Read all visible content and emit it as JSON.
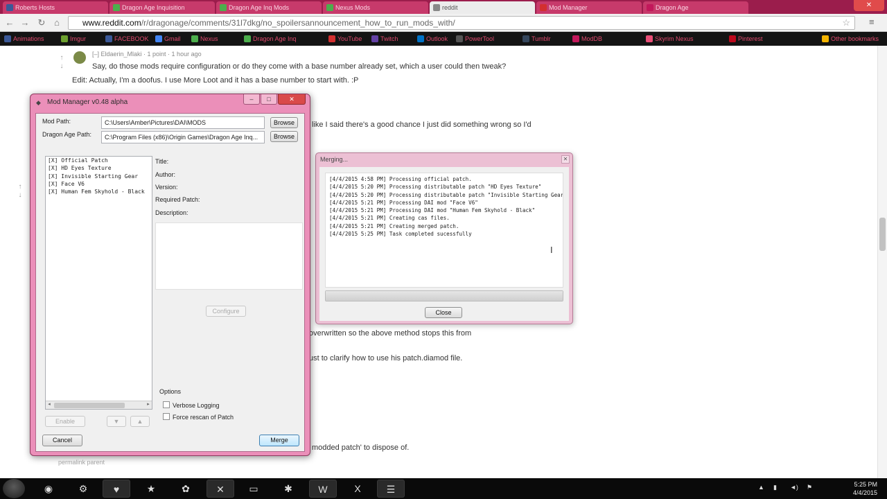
{
  "browser": {
    "tabs": [
      {
        "label": "Roberts Hosts",
        "color": "#3b5998",
        "active": false
      },
      {
        "label": "Dragon Age Inquisition",
        "color": "#4cae4c",
        "active": false
      },
      {
        "label": "Dragon Age Inq Mods",
        "color": "#4cae4c",
        "active": false
      },
      {
        "label": "Nexus Mods",
        "color": "#4cae4c",
        "active": false
      },
      {
        "label": "reddit",
        "color": "#888888",
        "active": true
      },
      {
        "label": "Mod Manager",
        "color": "#d32f2f",
        "active": false
      },
      {
        "label": "Dragon Age",
        "color": "#c2185b",
        "active": false
      }
    ],
    "url_host": "www.reddit.com",
    "url_path": "/r/dragonage/comments/31l7dkg/no_spoilersannouncement_how_to_run_mods_with/",
    "bookmarks": [
      {
        "label": "Animations",
        "color": "#3b5998"
      },
      {
        "label": "Imgur",
        "color": "#6ca02f"
      },
      {
        "label": "FACEBOOK",
        "color": "#3b5998"
      },
      {
        "label": "Gmail",
        "color": "#4285f4"
      },
      {
        "label": "Nexus",
        "color": "#4cae4c"
      },
      {
        "label": "Dragon Age Inq",
        "color": "#4cae4c"
      },
      {
        "label": "YouTube",
        "color": "#d32f2f"
      },
      {
        "label": "Twitch",
        "color": "#6441a5"
      },
      {
        "label": "Outlook",
        "color": "#0072c6"
      },
      {
        "label": "PowerTool",
        "color": "#555555"
      },
      {
        "label": "Tumblr",
        "color": "#35465c"
      },
      {
        "label": "ModDB",
        "color": "#c2185b"
      },
      {
        "label": "Skyrim Nexus",
        "color": "#e94e77"
      },
      {
        "label": "Pinterest",
        "color": "#bd081c"
      },
      {
        "label": "Other bookmarks",
        "color": "#f4b400"
      }
    ]
  },
  "reddit": {
    "comment_author": "Eldaerin_Mlaki",
    "comment_meta": "[–] Eldaerin_Mlaki · 1 point · 1 hour ago",
    "lines": [
      "Say, do those mods require configuration or do they come with a base number already set, which a user could then tweak?",
      "Edit: Actually, I'm a doofus. I use More Loot and it has a base number to start with. :P",
      "like I said there's a good chance I just did something wrong so I'd",
      "overwritten so the above method stops this from",
      "ust to clarify how to use his patch.diamod file.",
      "modded patch' to dispose of."
    ],
    "footer": "permalink   parent"
  },
  "mod_manager": {
    "title": "Mod Manager v0.48 alpha",
    "mod_path_label": "Mod Path:",
    "mod_path_value": "C:\\Users\\Amber\\Pictures\\DAI\\MODS",
    "dragon_age_path_label": "Dragon Age Path:",
    "dragon_age_path_value": "C:\\Program Files (x86)\\Origin Games\\Dragon Age Inq...",
    "browse_label": "Browse",
    "mods": [
      "[X] Official Patch",
      "[X] HD Eyes Texture",
      "[X] Invisible Starting Gear",
      "[X] Face V6",
      "[X] Human Fem Skyhold - Black"
    ],
    "details": {
      "title_label": "Title:",
      "author_label": "Author:",
      "version_label": "Version:",
      "required_patch_label": "Required Patch:",
      "description_label": "Description:"
    },
    "configure_label": "Configure",
    "enable_label": "Enable",
    "move_down_label": "▼",
    "move_up_label": "▲",
    "options_label": "Options",
    "verbose_logging_label": "Verbose Logging",
    "force_rescan_label": "Force rescan of Patch",
    "cancel_label": "Cancel",
    "merge_label": "Merge"
  },
  "merging": {
    "title": "Merging...",
    "log": [
      "[4/4/2015 4:58 PM] Processing official patch.",
      "[4/4/2015 5:20 PM] Processing distributable patch \"HD Eyes Texture\"",
      "[4/4/2015 5:20 PM] Processing distributable patch \"Invisible Starting Gear\"",
      "[4/4/2015 5:21 PM] Processing DAI mod \"Face V6\"",
      "[4/4/2015 5:21 PM] Processing DAI mod \"Human Fem Skyhold - Black\"",
      "[4/4/2015 5:21 PM] Creating cas files.",
      "[4/4/2015 5:21 PM] Creating merged patch.",
      "[4/4/2015 5:25 PM] Task completed sucessfully"
    ],
    "progress": 1.0,
    "close_label": "Close"
  },
  "taskbar": {
    "time": "5:25 PM",
    "date": "4/4/2015",
    "items": [
      "firefox-icon",
      "steam-icon",
      "heart-app-icon",
      "star-app-icon",
      "flower-app-icon",
      "x-app-icon",
      "folder-icon",
      "spider-app-icon",
      "word-icon",
      "excel-icon",
      "notepad-icon"
    ]
  },
  "colors": {
    "accent_pink": "#eb8fb9",
    "tab_strip": "#9b1d4c",
    "bookmark_text": "#e04a6e"
  }
}
